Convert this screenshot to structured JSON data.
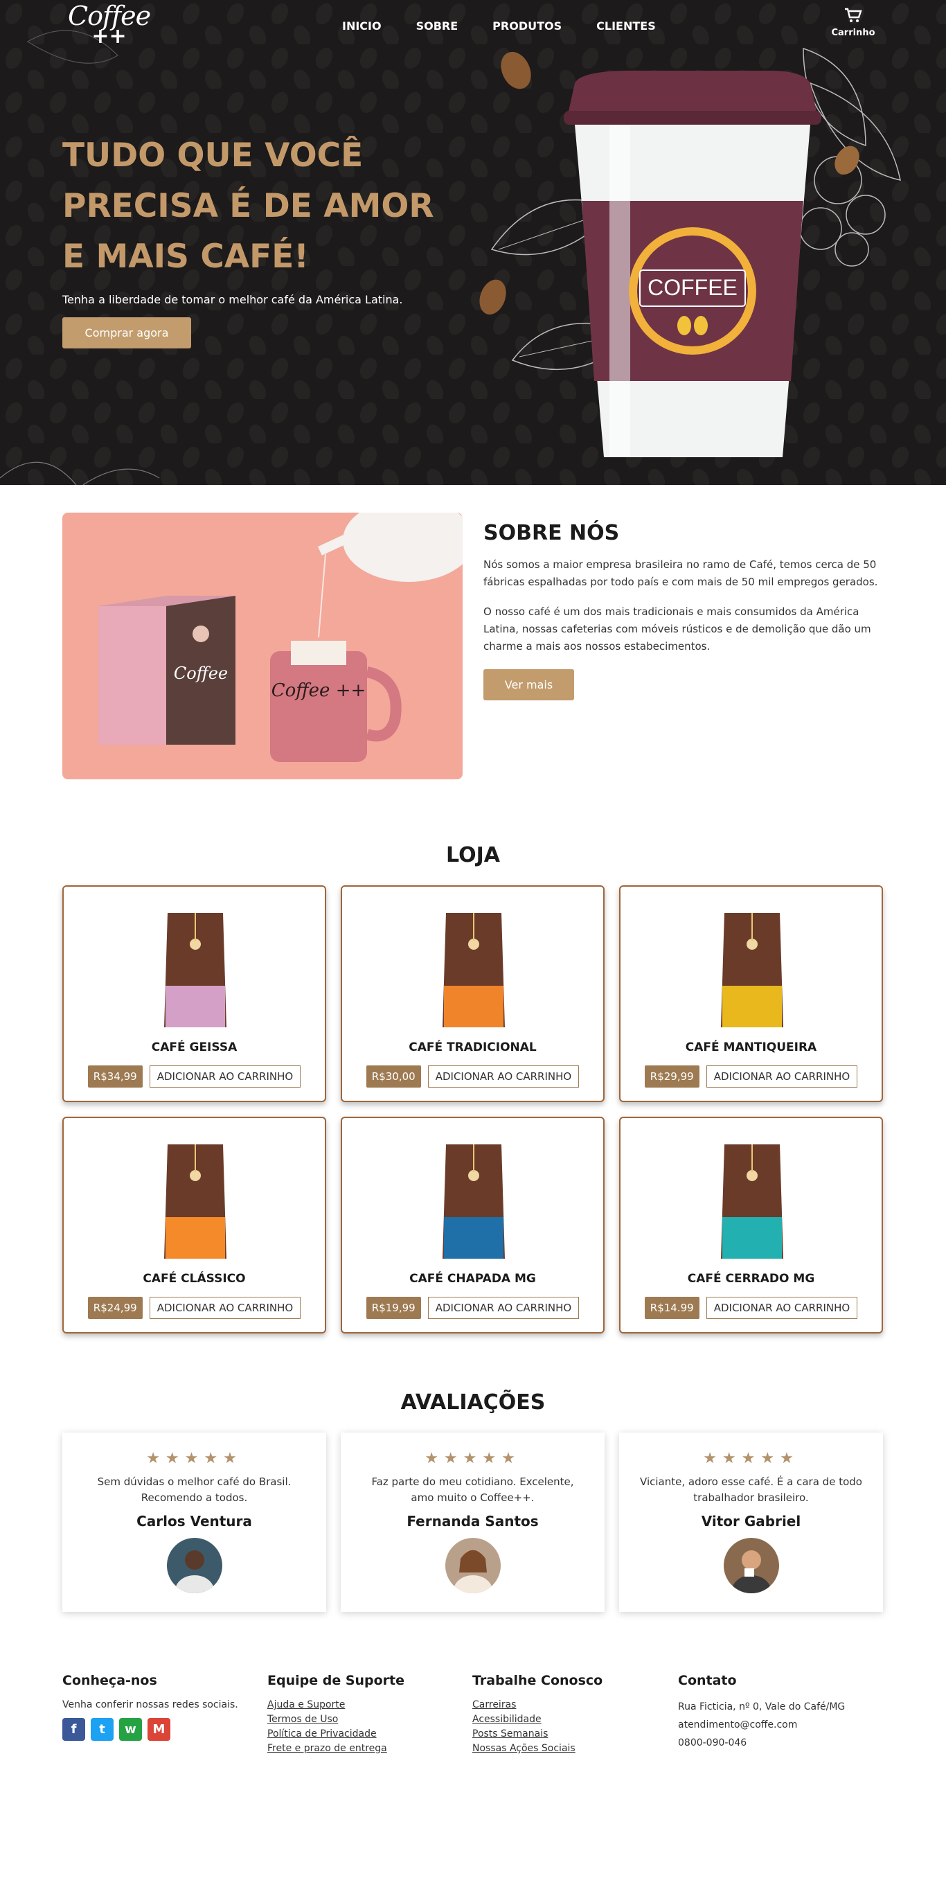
{
  "nav": {
    "logo_line1": "Coffee",
    "logo_line2": "++",
    "links": [
      "INICIO",
      "SOBRE",
      "PRODUTOS",
      "CLIENTES"
    ],
    "cart_label": "Carrinho",
    "cart_icon": "shopping-cart-icon"
  },
  "hero": {
    "title": "TUDO QUE VOCÊ PRECISA É DE AMOR E MAIS CAFÉ!",
    "subtitle": "Tenha a liberdade de tomar o melhor café da América Latina.",
    "button": "Comprar agora",
    "cup_label": "COFFEE"
  },
  "about": {
    "title": "SOBRE NÓS",
    "p1": "Nós somos a maior empresa brasileira no ramo de Café, temos cerca de 50 fábricas espalhadas por todo país e com mais de 50 mil empregos gerados.",
    "p2": "O nosso café é um dos mais tradicionais e mais consumidos da América Latina, nossas cafeterias com móveis rústicos e de demolição que dão um charme a mais aos nossos estabecimentos.",
    "button": "Ver mais",
    "box_brand": "Coffee",
    "mug_brand": "Coffee ++"
  },
  "store": {
    "title": "LOJA",
    "add_label": "ADICIONAR AO CARRINHO",
    "products": [
      {
        "name": "CAFÉ GEISSA",
        "price": "R$34,99",
        "color": "#d4a0c8"
      },
      {
        "name": "CAFÉ TRADICIONAL",
        "price": "R$30,00",
        "color": "#f0842a"
      },
      {
        "name": "CAFÉ MANTIQUEIRA",
        "price": "R$29,99",
        "color": "#e8b81c"
      },
      {
        "name": "CAFÉ CLÁSSICO",
        "price": "R$24,99",
        "color": "#f48a2a"
      },
      {
        "name": "CAFÉ CHAPADA MG",
        "price": "R$19,99",
        "color": "#1f6fa8"
      },
      {
        "name": "CAFÉ CERRADO MG",
        "price": "R$14.99",
        "color": "#22b0b0"
      }
    ]
  },
  "reviews": {
    "title": "AVALIAÇÕES",
    "stars": "★★★★★",
    "items": [
      {
        "text": "Sem dúvidas o melhor café do Brasil. Recomendo a todos.",
        "name": "Carlos Ventura"
      },
      {
        "text": "Faz parte do meu cotidiano. Excelente, amo muito o Coffee++.",
        "name": "Fernanda Santos"
      },
      {
        "text": "Viciante, adoro esse café. É a cara de todo trabalhador brasileiro.",
        "name": "Vitor Gabriel"
      }
    ]
  },
  "footer": {
    "col1": {
      "title": "Conheça-nos",
      "text": "Venha conferir nossas redes sociais."
    },
    "col2": {
      "title": "Equipe de Suporte",
      "links": [
        "Ajuda e Suporte",
        "Termos de Uso",
        "Política de Privacidade",
        "Frete e prazo de entrega"
      ]
    },
    "col3": {
      "title": "Trabalhe Conosco",
      "links": [
        "Carreiras",
        "Acessibilidade",
        "Posts Semanais",
        "Nossas Ações Sociais"
      ]
    },
    "col4": {
      "title": "Contato",
      "lines": [
        "Rua Ficticia, nº 0, Vale do Café/MG",
        "atendimento@coffe.com",
        "0800-090-046"
      ]
    },
    "socials": [
      {
        "icon": "facebook-icon",
        "glyph": "f",
        "color": "#3b5998"
      },
      {
        "icon": "twitter-icon",
        "glyph": "t",
        "color": "#1da1f2"
      },
      {
        "icon": "whatsapp-icon",
        "glyph": "w",
        "color": "#25a244"
      },
      {
        "icon": "gmail-icon",
        "glyph": "M",
        "color": "#db4437"
      }
    ]
  }
}
